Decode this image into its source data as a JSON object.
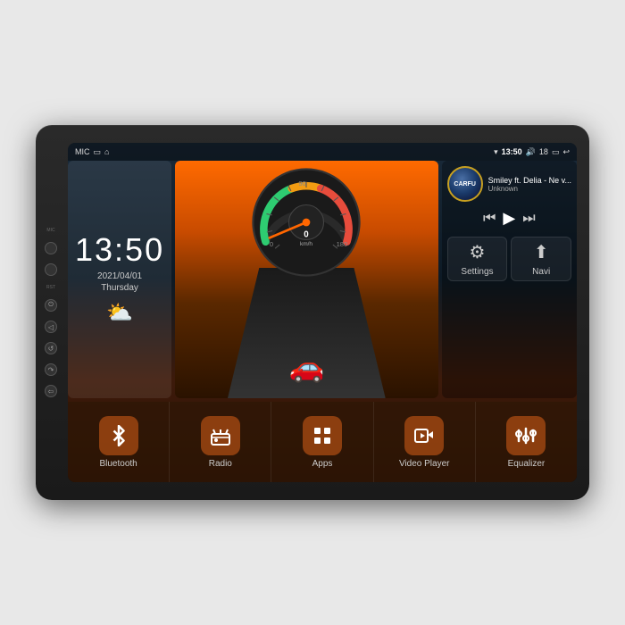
{
  "unit": {
    "housing_label": "Car Head Unit"
  },
  "status_bar": {
    "mic_label": "MIC",
    "wifi_icon": "📶",
    "time": "13:50",
    "volume_icon": "🔊",
    "volume_level": "18",
    "back_icon": "↩"
  },
  "clock": {
    "time": "13:50",
    "date": "2021/04/01",
    "day": "Thursday",
    "weather_icon": "⛅"
  },
  "speedometer": {
    "value": "0",
    "unit": "km/h",
    "max": "180"
  },
  "media": {
    "album_art_text": "CARFU",
    "title": "Smiley ft. Delia - Ne v...",
    "artist": "Unknown",
    "prev_icon": "⏮",
    "play_icon": "▶",
    "next_icon": "⏭"
  },
  "functions": {
    "settings_label": "Settings",
    "settings_icon": "⚙",
    "navi_label": "Navi",
    "navi_icon": "🧭"
  },
  "apps": [
    {
      "id": "bluetooth",
      "label": "Bluetooth",
      "icon": "bluetooth"
    },
    {
      "id": "radio",
      "label": "Radio",
      "icon": "radio"
    },
    {
      "id": "apps",
      "label": "Apps",
      "icon": "apps"
    },
    {
      "id": "video",
      "label": "Video Player",
      "icon": "video"
    },
    {
      "id": "equalizer",
      "label": "Equalizer",
      "icon": "equalizer"
    }
  ],
  "side_buttons": [
    {
      "id": "mic",
      "label": "MIC"
    },
    {
      "id": "rst",
      "label": "RST"
    },
    {
      "id": "power",
      "label": "⏻"
    },
    {
      "id": "b1",
      "label": ""
    },
    {
      "id": "b2",
      "label": ""
    },
    {
      "id": "b3",
      "label": ""
    },
    {
      "id": "b4",
      "label": ""
    }
  ]
}
